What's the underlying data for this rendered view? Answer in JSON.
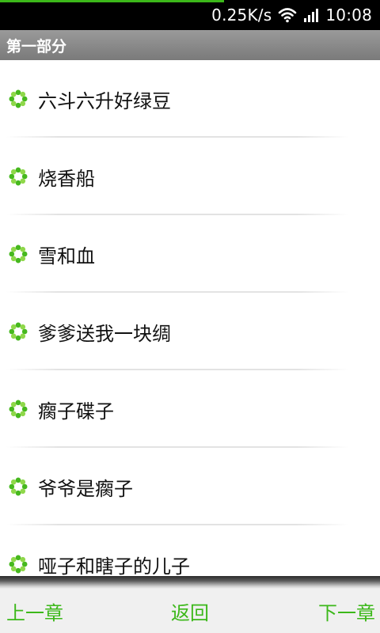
{
  "status_bar": {
    "network_speed": "0.25K/s",
    "time": "10:08",
    "progress": 0.59,
    "wifi_icon": "wifi-icon",
    "signal_icon": "signal-icon"
  },
  "section": {
    "title": "第一部分"
  },
  "chapters": [
    {
      "title": "六斗六升好绿豆"
    },
    {
      "title": "烧香船"
    },
    {
      "title": "雪和血"
    },
    {
      "title": "爹爹送我一块绸"
    },
    {
      "title": "瘸子碟子"
    },
    {
      "title": "爷爷是瘸子"
    },
    {
      "title": "哑子和瞎子的儿子"
    }
  ],
  "chapter_icon": "green-flower-bullet-icon",
  "colors": {
    "accent": "#3cb81a",
    "header_bg": "#8a8a8a",
    "status_bg": "#000000"
  },
  "nav": {
    "prev_label": "上一章",
    "back_label": "返回",
    "next_label": "下一章"
  }
}
